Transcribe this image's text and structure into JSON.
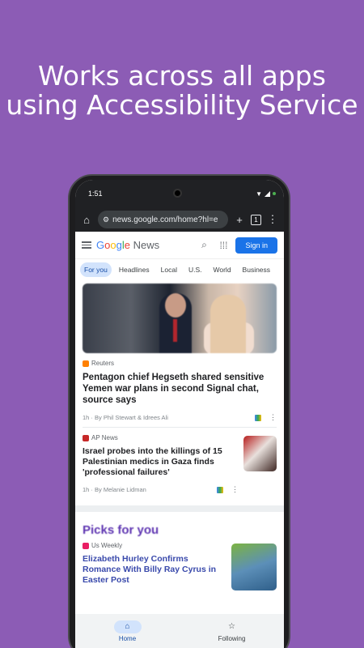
{
  "promo": {
    "line1": "Works across all apps",
    "line2": "using Accessibility Service"
  },
  "status_bar": {
    "time": "1:51"
  },
  "browser": {
    "url": "news.google.com/home?hl=e",
    "tab_count": "1"
  },
  "header": {
    "logo_letters": [
      "G",
      "o",
      "o",
      "g",
      "l",
      "e"
    ],
    "logo_suffix": "News",
    "sign_in_label": "Sign in"
  },
  "tabs": [
    {
      "label": "For you",
      "active": true
    },
    {
      "label": "Headlines"
    },
    {
      "label": "Local"
    },
    {
      "label": "U.S."
    },
    {
      "label": "World"
    },
    {
      "label": "Business"
    }
  ],
  "articles": [
    {
      "source": "Reuters",
      "title": "Pentagon chief Hegseth shared sensitive Yemen war plans in second Signal chat, source says",
      "meta": "1h · By Phil Stewart & Idrees Ali"
    },
    {
      "source": "AP News",
      "title": "Israel probes into the killings of 15 Palestinian medics in Gaza finds 'professional failures'",
      "meta": "1h · By Melanie Lidman"
    }
  ],
  "picks": {
    "heading": "Picks for you",
    "article": {
      "source": "Us Weekly",
      "title": "Elizabeth Hurley Confirms Romance With Billy Ray Cyrus in Easter Post"
    }
  },
  "bottom_nav": {
    "home_label": "Home",
    "following_label": "Following"
  },
  "colors": {
    "background": "#8c5cb5",
    "accent": "#1a73e8",
    "picks_heading": "#5e35b1"
  }
}
